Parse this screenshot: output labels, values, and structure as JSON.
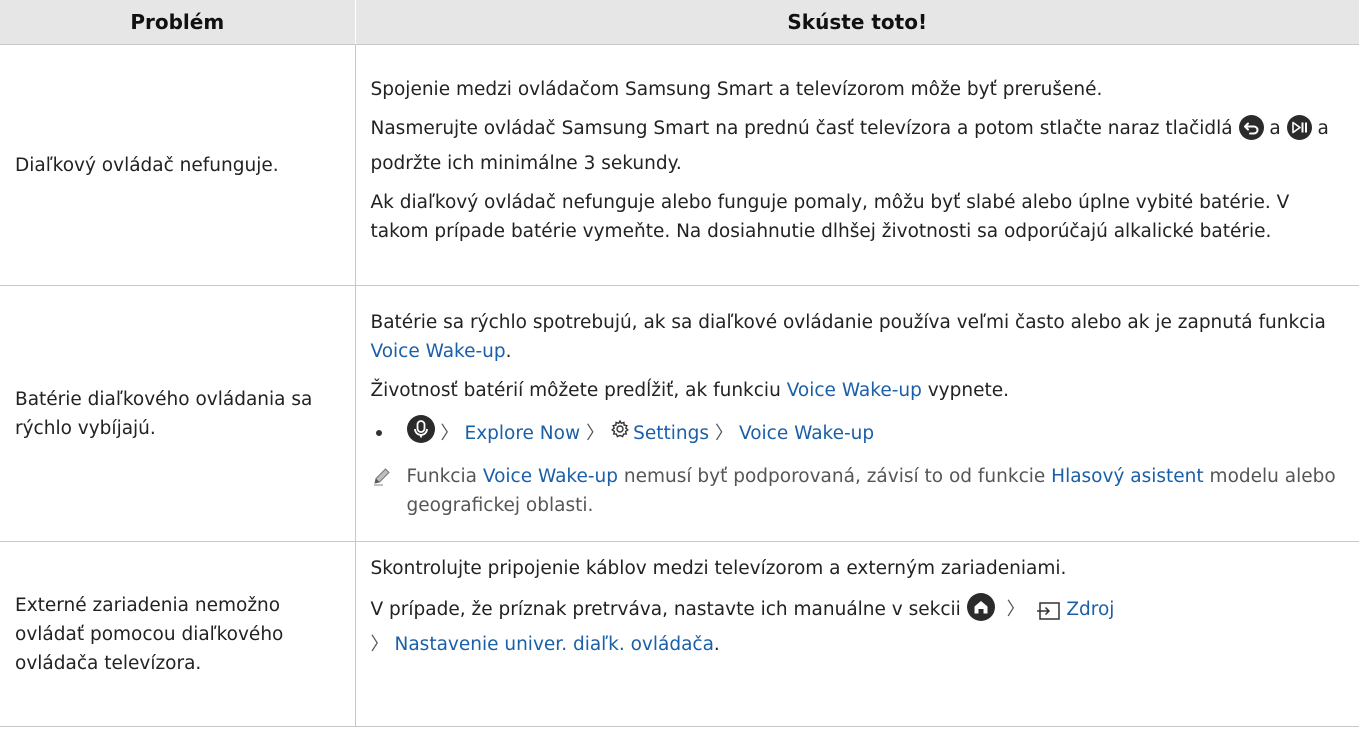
{
  "header": {
    "problem": "Problém",
    "solution": "Skúste toto!"
  },
  "row1": {
    "problem": "Diaľkový ovládač nefunguje.",
    "p1": "Spojenie medzi ovládačom Samsung Smart a televízorom môže byť prerušené.",
    "p2a": "Nasmerujte ovládač Samsung Smart na prednú časť televízora a potom stlačte naraz tlačidlá",
    "p2b": "a",
    "p2c": "a podržte ich minimálne 3 sekundy.",
    "p3": "Ak diaľkový ovládač nefunguje alebo funguje pomaly, môžu byť slabé alebo úplne vybité batérie. V takom prípade batérie vymeňte. Na dosiahnutie dlhšej životnosti sa odporúčajú alkalické batérie."
  },
  "row2": {
    "problem": "Batérie diaľkového ovládania sa rýchlo vybíjajú.",
    "p1a": "Batérie sa rýchlo spotrebujú, ak sa diaľkové ovládanie používa veľmi často alebo ak je zapnutá funkcia",
    "p1link": "Voice Wake-up",
    "p1b": ".",
    "p2a": "Životnosť batérií môžete predĺžiť, ak funkciu",
    "p2link": "Voice Wake-up",
    "p2b": "vypnete.",
    "path": {
      "explore": "Explore Now",
      "settings": "Settings",
      "wake": "Voice Wake-up"
    },
    "note": {
      "a": "Funkcia",
      "link1": "Voice Wake-up",
      "b": "nemusí byť podporovaná, závisí to od funkcie",
      "link2": "Hlasový asistent",
      "c": "modelu alebo geografickej oblasti."
    }
  },
  "row3": {
    "problem": "Externé zariadenia nemožno ovládať pomocou diaľkového ovládača televízora.",
    "p1": "Skontrolujte pripojenie káblov medzi televízorom a externým zariadeniami.",
    "p2a": "V prípade, že príznak pretrváva, nastavte ich manuálne v sekcii",
    "zdroj": "Zdroj",
    "nastavenie": "Nastavenie univer. diaľk. ovládača",
    "end": "."
  },
  "colors": {
    "link": "#1a5fa8",
    "header_bg": "#e6e6e6",
    "border": "#c8c8c8"
  }
}
